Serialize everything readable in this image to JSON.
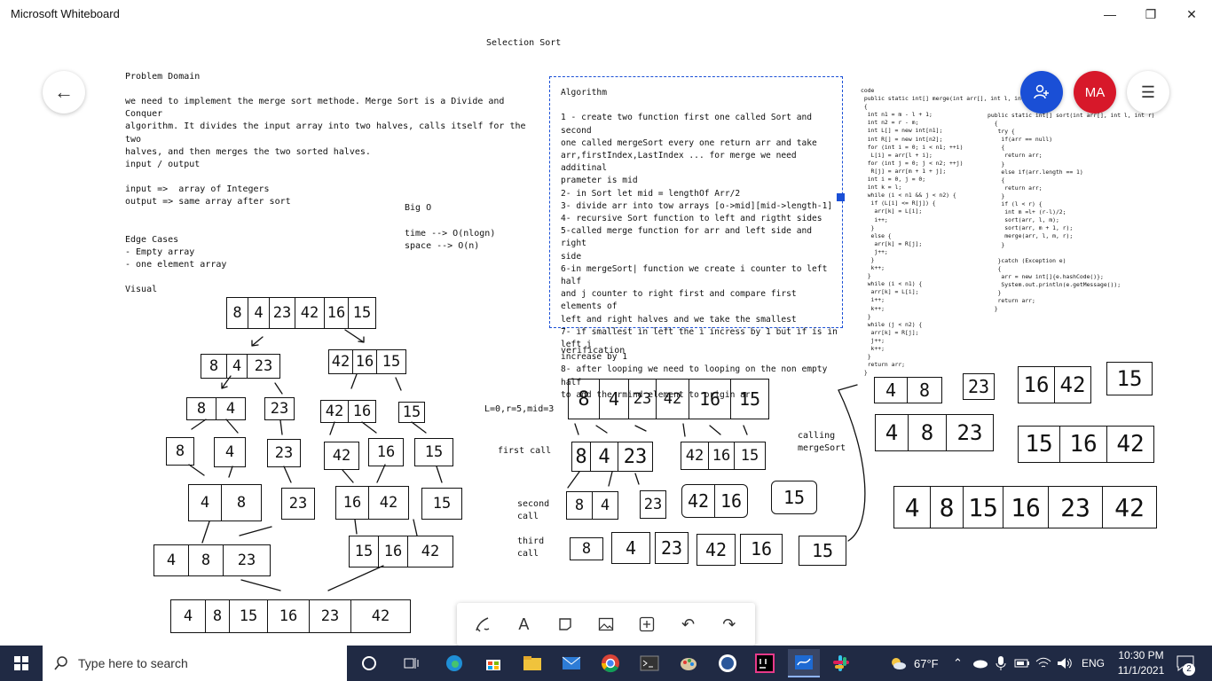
{
  "window": {
    "title": "Microsoft Whiteboard",
    "minimize": "—",
    "restore": "❐",
    "close": "✕"
  },
  "board": {
    "heading": "Selection Sort",
    "problem_title": "Problem Domain",
    "problem_text": "we need to implement the merge sort methode. Merge Sort is a Divide and Conquer\nalgorithm. It divides the input array into two halves, calls itself for the two\nhalves, and then merges the two sorted halves.",
    "io_title": "input / output",
    "io_text": "input =>  array of Integers\noutput => same array after sort",
    "edge_text": "Edge Cases\n- Empty array\n- one element array",
    "visual_label": "Visual",
    "bigo_title": "Big O",
    "bigo_text": "time --> O(nlogn)\nspace --> O(n)",
    "algorithm_text": "Algorithm\n\n1 - create two function first one called Sort and second\none called mergeSort every one return arr and take\narr,firstIndex,LastIndex ... for merge we need additinal\nprameter is mid\n2- in Sort let mid = lengthOf Arr/2\n3- divide arr into tow arrays [o->mid][mid->length-1]\n4- recursive Sort function to left and rigtht sides\n5-called merge function for arr and left side and right\nside\n6-in mergeSort| function we create i counter to left half\nand j counter to right first and compare first elements of\nleft and right halves and we take the smallest\n7- if smallest in left the i incress by 1 but if is in left j\nincrease by 1\n8- after looping we need to looping on the non empty half\nto add the rmind element to origin arr",
    "verification_label": "verification",
    "lr_label": "L=0,r=5,mid=3",
    "first_call": "first call",
    "second_call": "second\ncall",
    "third_call": "third\ncall",
    "calling_merge": "calling\nmergeSort",
    "code_left": "code\n public static int[] merge(int arr[], int l, int m, int r)\n {\n  int n1 = m - l + 1;\n  int n2 = r - m;\n  int L[] = new int[n1];\n  int R[] = new int[n2];\n  for (int i = 0; i < n1; ++i)\n   L[i] = arr[l + i];\n  for (int j = 0; j < n2; ++j)\n   R[j] = arr[m + 1 + j];\n  int i = 0, j = 0;\n  int k = l;\n  while (i < n1 && j < n2) {\n   if (L[i] <= R[j]) {\n    arr[k] = L[i];\n    i++;\n   }\n   else {\n    arr[k] = R[j];\n    j++;\n   }\n   k++;\n  }\n  while (i < n1) {\n   arr[k] = L[i];\n   i++;\n   k++;\n  }\n  while (j < n2) {\n   arr[k] = R[j];\n   j++;\n   k++;\n  }\n  return arr;\n }",
    "code_right": "public static int[] sort(int arr[], int l, int r)\n  {\n   try {\n    if(arr == null)\n    {\n     return arr;\n    }\n    else if(arr.length == 1)\n    {\n     return arr;\n    }\n    if (l < r) {\n     int m =l+ (r-l)/2;\n     sort(arr, l, m);\n     sort(arr, m + 1, r);\n     merge(arr, l, m, r);\n    }\n\n   }catch (Exception e)\n   {\n    arr = new int[]{e.hashCode()};\n    System.out.println(e.getMessage());\n   }\n   return arr;\n  }"
  },
  "arrays": {
    "root": [
      "8",
      "4",
      "23",
      "42",
      "16",
      "15"
    ],
    "l1_left": [
      "8",
      "4",
      "23"
    ],
    "l1_right": [
      "42",
      "16",
      "15"
    ],
    "l2_a": [
      "8",
      "4"
    ],
    "l2_b": [
      "23"
    ],
    "l2_c": [
      "42",
      "16"
    ],
    "l2_d": [
      "15"
    ],
    "l3": [
      "8",
      "4",
      "23",
      "42",
      "16",
      "15"
    ],
    "l4_a": [
      "4",
      "8"
    ],
    "l4_b": [
      "23"
    ],
    "l4_c": [
      "16",
      "42"
    ],
    "l4_d": [
      "15"
    ],
    "l5_left": [
      "4",
      "8",
      "23"
    ],
    "l5_right": [
      "15",
      "16",
      "42"
    ],
    "final": [
      "4",
      "8",
      "15",
      "16",
      "23",
      "42"
    ],
    "v_root": [
      "8",
      "4",
      "23",
      "42",
      "16",
      "15"
    ],
    "v_first_left": [
      "8",
      "4",
      "23"
    ],
    "v_first_right": [
      "42",
      "16",
      "15"
    ],
    "v_second": [
      [
        "8",
        "4"
      ],
      [
        "23"
      ],
      [
        "42",
        "16"
      ],
      [
        "15"
      ]
    ],
    "v_third": [
      "8",
      "4",
      "23",
      "42",
      "16",
      "15"
    ],
    "m_row1": [
      [
        "4",
        "8"
      ],
      [
        "23"
      ],
      [
        "16",
        "42"
      ],
      [
        "15"
      ]
    ],
    "m_row2_left": [
      "4",
      "8",
      "23"
    ],
    "m_row2_right": [
      "15",
      "16",
      "42"
    ],
    "m_final": [
      "4",
      "8",
      "15",
      "16",
      "23",
      "42"
    ]
  },
  "floating": {
    "back": "←",
    "avatar_initials": "MA",
    "menu": "☰"
  },
  "toolbar": {
    "pen": "pen-tool",
    "text": "A",
    "note": "note",
    "image": "image",
    "insert": "+",
    "undo": "↶",
    "redo": "↷"
  },
  "taskbar": {
    "search_placeholder": "Type here to search",
    "weather": "67°F",
    "lang": "ENG",
    "time": "10:30 PM",
    "date": "11/1/2021",
    "notifications": "2"
  },
  "colors": {
    "accent_blue": "#1a4fd6",
    "avatar_red": "#d7182a",
    "taskbar": "#202a44"
  }
}
